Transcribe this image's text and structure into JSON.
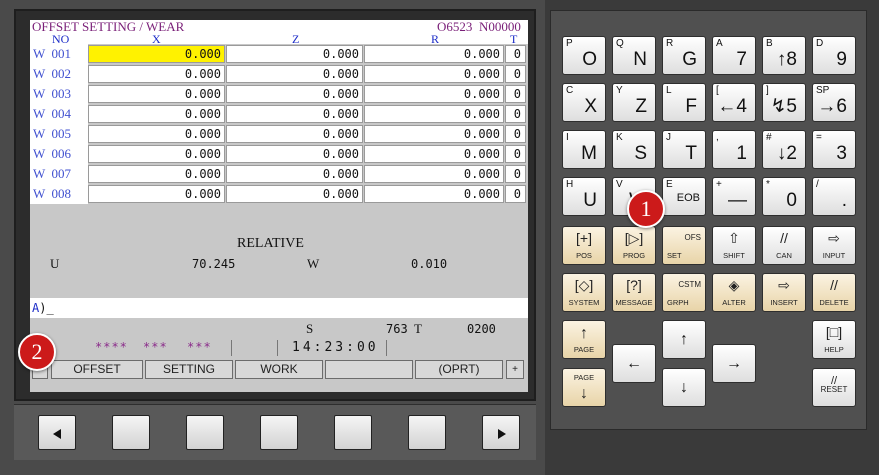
{
  "header": {
    "title": "OFFSET SETTING / WEAR",
    "program": "O6523",
    "sequence": "N00000"
  },
  "columns": {
    "no": "NO",
    "x": "X",
    "z": "Z",
    "r": "R",
    "t": "T"
  },
  "rows": [
    {
      "no": "W  001",
      "x": "0.000",
      "z": "0.000",
      "r": "0.000",
      "t": "0"
    },
    {
      "no": "W  002",
      "x": "0.000",
      "z": "0.000",
      "r": "0.000",
      "t": "0"
    },
    {
      "no": "W  003",
      "x": "0.000",
      "z": "0.000",
      "r": "0.000",
      "t": "0"
    },
    {
      "no": "W  004",
      "x": "0.000",
      "z": "0.000",
      "r": "0.000",
      "t": "0"
    },
    {
      "no": "W  005",
      "x": "0.000",
      "z": "0.000",
      "r": "0.000",
      "t": "0"
    },
    {
      "no": "W  006",
      "x": "0.000",
      "z": "0.000",
      "r": "0.000",
      "t": "0"
    },
    {
      "no": "W  007",
      "x": "0.000",
      "z": "0.000",
      "r": "0.000",
      "t": "0"
    },
    {
      "no": "W  008",
      "x": "0.000",
      "z": "0.000",
      "r": "0.000",
      "t": "0"
    }
  ],
  "relative": {
    "title": "RELATIVE",
    "u_label": "U",
    "u_value": "70.245",
    "w_label": "W",
    "w_value": "0.010"
  },
  "input": {
    "prompt": "A",
    "cursor": ")_"
  },
  "status": {
    "s_label": "S",
    "s_value": "763",
    "t_label": "T",
    "t_value": "0200",
    "stars1": "****",
    "stars2": "***",
    "stars3": "***",
    "time": "14:23:00"
  },
  "softkeys": {
    "offset": "OFFSET",
    "setting": "SETTING",
    "work": "WORK",
    "blank": "",
    "oprt": "(OPRT)",
    "plus": "+"
  },
  "badges": {
    "one": "1",
    "two": "2"
  },
  "keypad": {
    "row1": [
      {
        "sub": "P",
        "main": "O"
      },
      {
        "sub": "Q",
        "main": "N"
      },
      {
        "sub": "R",
        "main": "G"
      },
      {
        "sub": "A",
        "main": "7"
      },
      {
        "sub": "B",
        "main": "↑8"
      },
      {
        "sub": "D",
        "main": "9"
      }
    ],
    "row2": [
      {
        "sub": "C",
        "main": "X"
      },
      {
        "sub": "Y",
        "main": "Z"
      },
      {
        "sub": "L",
        "main": "F"
      },
      {
        "sub": "[",
        "main": "←4"
      },
      {
        "sub": "]",
        "main": "↯5"
      },
      {
        "sub": "SP",
        "main": "→6"
      }
    ],
    "row3": [
      {
        "sub": "I",
        "main": "M"
      },
      {
        "sub": "K",
        "main": "S"
      },
      {
        "sub": "J",
        "main": "T"
      },
      {
        "sub": ",",
        "main": "1"
      },
      {
        "sub": "#",
        "main": "↓2"
      },
      {
        "sub": "=",
        "main": "3"
      }
    ],
    "row4": [
      {
        "sub": "H",
        "main": "U"
      },
      {
        "sub": "V",
        "main": "W"
      },
      {
        "sub": "E",
        "main": "EOB"
      },
      {
        "sub": "+",
        "main": "—"
      },
      {
        "sub": "*",
        "main": "0"
      },
      {
        "sub": "/",
        "main": "."
      }
    ],
    "func1": [
      {
        "icon": "[+]",
        "label": "POS"
      },
      {
        "icon": "[▷]",
        "label": "PROG"
      },
      {
        "icon": "OFS",
        "label": "SET"
      },
      {
        "icon": "⇧",
        "label": "SHIFT"
      },
      {
        "icon": "//",
        "label": "CAN"
      },
      {
        "icon": "⇨",
        "label": "INPUT"
      }
    ],
    "func2": [
      {
        "icon": "[◇]",
        "label": "SYSTEM"
      },
      {
        "icon": "[?]",
        "label": "MESSAGE"
      },
      {
        "icon": "CSTM",
        "label": "GRPH"
      },
      {
        "icon": "◈",
        "label": "ALTER"
      },
      {
        "icon": "⇨",
        "label": "INSERT"
      },
      {
        "icon": "//",
        "label": "DELETE"
      }
    ],
    "page_up": {
      "arrow": "↑",
      "label": "PAGE"
    },
    "page_down": {
      "arrow": "↓",
      "label": "PAGE"
    },
    "help": {
      "icon": "[□]",
      "label": "HELP"
    },
    "reset": {
      "label": "RESET"
    }
  }
}
